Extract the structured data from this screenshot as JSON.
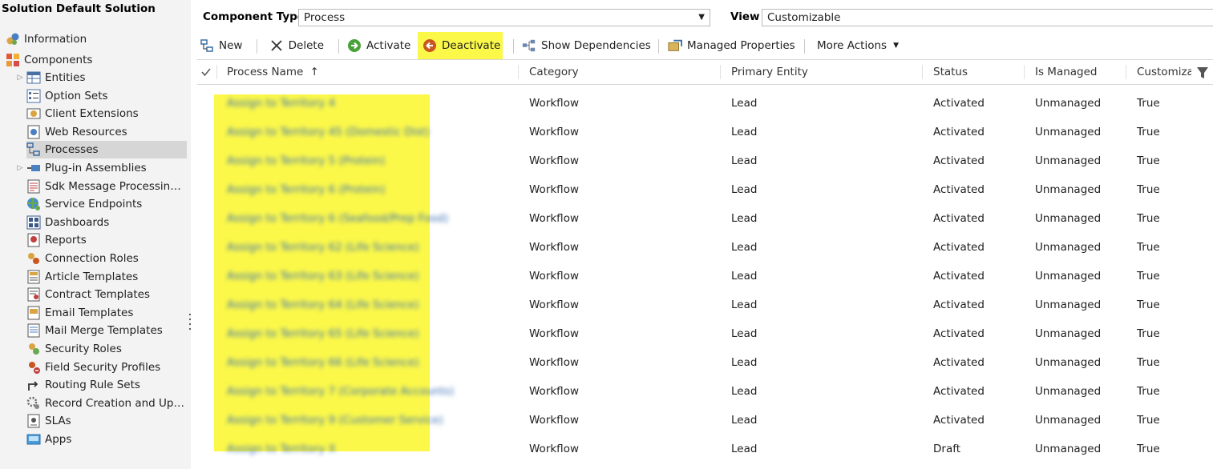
{
  "solution_title": "Solution Default Solution",
  "nav": {
    "information": "Information",
    "components": "Components",
    "items": [
      {
        "label": "Entities",
        "icon": "entities-icon",
        "expandable": true
      },
      {
        "label": "Option Sets",
        "icon": "option-sets-icon"
      },
      {
        "label": "Client Extensions",
        "icon": "client-extensions-icon"
      },
      {
        "label": "Web Resources",
        "icon": "web-resources-icon"
      },
      {
        "label": "Processes",
        "icon": "processes-icon",
        "selected": true
      },
      {
        "label": "Plug-in Assemblies",
        "icon": "plugin-assemblies-icon",
        "expandable": true
      },
      {
        "label": "Sdk Message Processing St...",
        "icon": "sdk-message-icon"
      },
      {
        "label": "Service Endpoints",
        "icon": "service-endpoints-icon"
      },
      {
        "label": "Dashboards",
        "icon": "dashboards-icon"
      },
      {
        "label": "Reports",
        "icon": "reports-icon"
      },
      {
        "label": "Connection Roles",
        "icon": "connection-roles-icon"
      },
      {
        "label": "Article Templates",
        "icon": "article-templates-icon"
      },
      {
        "label": "Contract Templates",
        "icon": "contract-templates-icon"
      },
      {
        "label": "Email Templates",
        "icon": "email-templates-icon"
      },
      {
        "label": "Mail Merge Templates",
        "icon": "mail-merge-templates-icon"
      },
      {
        "label": "Security Roles",
        "icon": "security-roles-icon"
      },
      {
        "label": "Field Security Profiles",
        "icon": "field-security-profiles-icon"
      },
      {
        "label": "Routing Rule Sets",
        "icon": "routing-rule-sets-icon"
      },
      {
        "label": "Record Creation and Upda...",
        "icon": "record-creation-icon"
      },
      {
        "label": "SLAs",
        "icon": "slas-icon"
      },
      {
        "label": "Apps",
        "icon": "apps-icon"
      }
    ]
  },
  "filters": {
    "component_type_label": "Component Type",
    "component_type_value": "Process",
    "view_label": "View",
    "view_value": "Customizable"
  },
  "toolbar": {
    "new": "New",
    "delete": "Delete",
    "activate": "Activate",
    "deactivate": "Deactivate",
    "show_dependencies": "Show Dependencies",
    "managed_properties": "Managed Properties",
    "more_actions": "More Actions"
  },
  "grid": {
    "columns": {
      "process_name": "Process Name",
      "category": "Category",
      "primary_entity": "Primary Entity",
      "status": "Status",
      "is_managed": "Is Managed",
      "customizable": "Customiza"
    },
    "rows": [
      {
        "name": "Assign to Territory 4",
        "category": "Workflow",
        "entity": "Lead",
        "status": "Activated",
        "managed": "Unmanaged",
        "customizable": "True"
      },
      {
        "name": "Assign to Territory 45 (Domestic Dist)",
        "category": "Workflow",
        "entity": "Lead",
        "status": "Activated",
        "managed": "Unmanaged",
        "customizable": "True"
      },
      {
        "name": "Assign to Territory 5 (Protein)",
        "category": "Workflow",
        "entity": "Lead",
        "status": "Activated",
        "managed": "Unmanaged",
        "customizable": "True"
      },
      {
        "name": "Assign to Territory 6 (Protein)",
        "category": "Workflow",
        "entity": "Lead",
        "status": "Activated",
        "managed": "Unmanaged",
        "customizable": "True"
      },
      {
        "name": "Assign to Territory 6 (Seafood/Prep Food)",
        "category": "Workflow",
        "entity": "Lead",
        "status": "Activated",
        "managed": "Unmanaged",
        "customizable": "True"
      },
      {
        "name": "Assign to Territory 62 (Life Science)",
        "category": "Workflow",
        "entity": "Lead",
        "status": "Activated",
        "managed": "Unmanaged",
        "customizable": "True"
      },
      {
        "name": "Assign to Territory 63 (Life Science)",
        "category": "Workflow",
        "entity": "Lead",
        "status": "Activated",
        "managed": "Unmanaged",
        "customizable": "True"
      },
      {
        "name": "Assign to Territory 64 (Life Science)",
        "category": "Workflow",
        "entity": "Lead",
        "status": "Activated",
        "managed": "Unmanaged",
        "customizable": "True"
      },
      {
        "name": "Assign to Territory 65 (Life Science)",
        "category": "Workflow",
        "entity": "Lead",
        "status": "Activated",
        "managed": "Unmanaged",
        "customizable": "True"
      },
      {
        "name": "Assign to Territory 66 (Life Science)",
        "category": "Workflow",
        "entity": "Lead",
        "status": "Activated",
        "managed": "Unmanaged",
        "customizable": "True"
      },
      {
        "name": "Assign to Territory 7 (Corporate Accounts)",
        "category": "Workflow",
        "entity": "Lead",
        "status": "Activated",
        "managed": "Unmanaged",
        "customizable": "True"
      },
      {
        "name": "Assign to Territory 9 (Customer Service)",
        "category": "Workflow",
        "entity": "Lead",
        "status": "Activated",
        "managed": "Unmanaged",
        "customizable": "True"
      },
      {
        "name": "Assign to Territory X",
        "category": "Workflow",
        "entity": "Lead",
        "status": "Draft",
        "managed": "Unmanaged",
        "customizable": "True"
      }
    ]
  },
  "colors": {
    "highlight": "#fbf84a",
    "selected_nav": "#d6d6d6",
    "left_pane_bg": "#f3f3f3"
  }
}
